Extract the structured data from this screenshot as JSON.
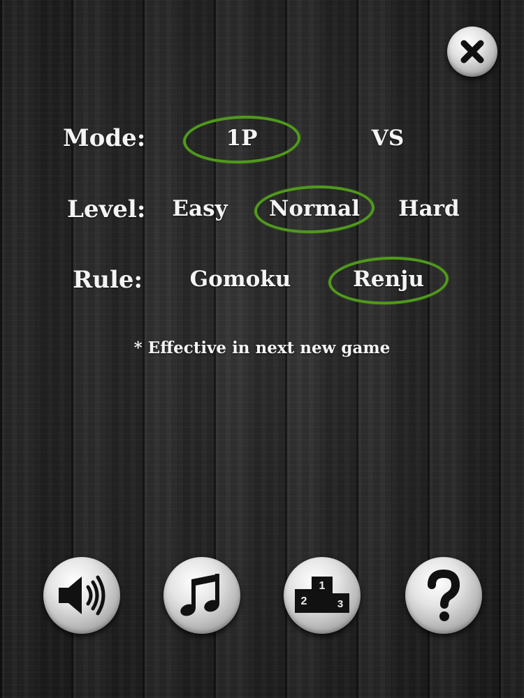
{
  "settings": {
    "mode": {
      "label": "Mode:",
      "options": [
        "1P",
        "VS"
      ],
      "selected": "1P"
    },
    "level": {
      "label": "Level:",
      "options": [
        "Easy",
        "Normal",
        "Hard"
      ],
      "selected": "Normal"
    },
    "rule": {
      "label": "Rule:",
      "options": [
        "Gomoku",
        "Renju"
      ],
      "selected": "Renju"
    },
    "note": "* Effective in next new game"
  },
  "leaderboard": {
    "podium_numbers": [
      "1",
      "2",
      "3"
    ]
  },
  "icons": {
    "close": "close-icon",
    "sound": "speaker-icon",
    "music": "music-note-icon",
    "leaderboard": "podium-icon",
    "help": "question-mark-icon"
  },
  "colors": {
    "selection_ring": "#4f9a1c",
    "text": "#f4f4f4",
    "button_face": "#e4e4e4",
    "button_glyph": "#111111"
  }
}
